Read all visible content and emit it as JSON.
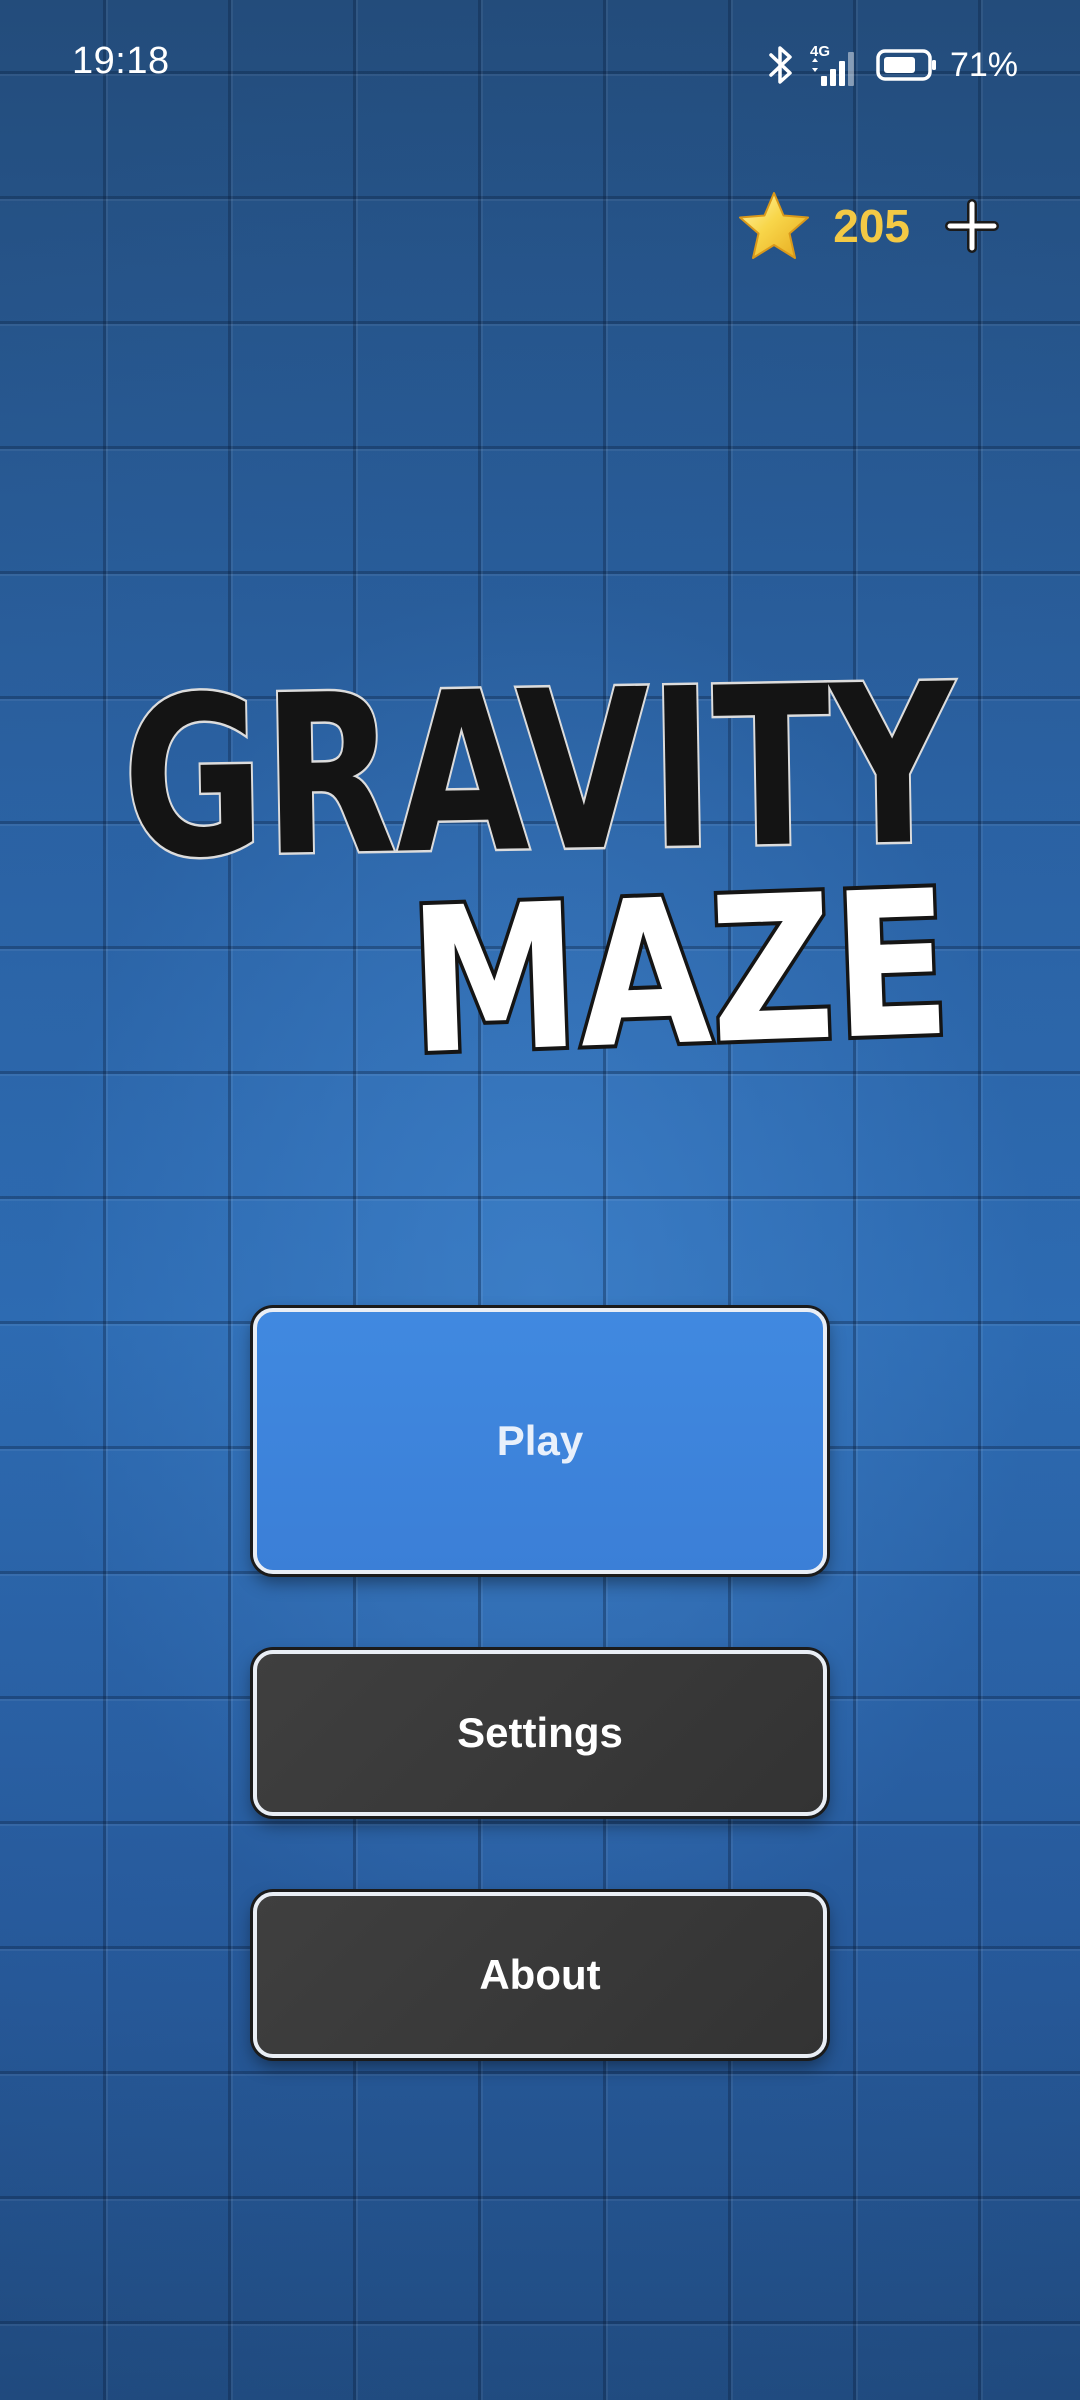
{
  "status_bar": {
    "time": "19:18",
    "network_label": "4G",
    "battery_percent": "71%",
    "icons": [
      "bluetooth-icon",
      "signal-icon",
      "battery-icon"
    ]
  },
  "coins": {
    "count": "205",
    "icon": "star-icon",
    "add_icon": "plus-icon"
  },
  "title": {
    "line1": "GRAVITY",
    "line2": "MAZE"
  },
  "menu": {
    "play_label": "Play",
    "settings_label": "Settings",
    "about_label": "About"
  },
  "colors": {
    "accent_blue": "#3b7fd7",
    "dark_button": "#363636",
    "coin_yellow": "#f3c945",
    "background": "#2b62a3"
  }
}
